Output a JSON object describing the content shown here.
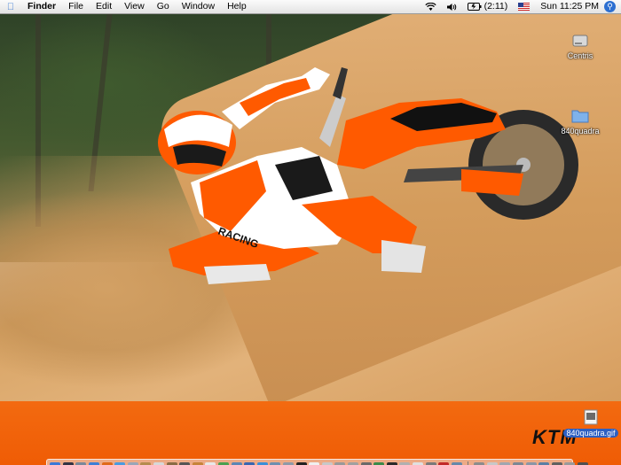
{
  "menubar": {
    "app_name": "Finder",
    "menus": [
      "File",
      "Edit",
      "View",
      "Go",
      "Window",
      "Help"
    ],
    "battery": "(2:11)",
    "clock": "Sun 11:25 PM"
  },
  "desktop": {
    "icons": [
      {
        "label": "Centris",
        "icon": "hard-drive-icon"
      },
      {
        "label": "840quadra",
        "icon": "folder-icon"
      },
      {
        "label": "840quadra.gif",
        "icon": "image-file-icon"
      }
    ],
    "wallpaper_logo": "KTM",
    "wallpaper_rider_text": "RACING"
  },
  "colors": {
    "brand_orange": "#ef5c05",
    "menubar": "#e8e8e8",
    "selection_blue": "#2d5fc2"
  },
  "dock": {
    "apps": [
      {
        "name": "finder-icon",
        "color": "#3b78d8"
      },
      {
        "name": "dashboard-icon",
        "color": "#333344"
      },
      {
        "name": "system-preferences-icon",
        "color": "#7a8899"
      },
      {
        "name": "safari-icon",
        "color": "#3d7fd6"
      },
      {
        "name": "firefox-icon",
        "color": "#e06a1a"
      },
      {
        "name": "ichat-icon",
        "color": "#4a9be0"
      },
      {
        "name": "mail-icon",
        "color": "#9aa6b8"
      },
      {
        "name": "address-book-icon",
        "color": "#b58c4e"
      },
      {
        "name": "textedit-icon",
        "color": "#d8d8d8"
      },
      {
        "name": "preview-icon",
        "color": "#8a6c44"
      },
      {
        "name": "imovie-icon",
        "color": "#555555"
      },
      {
        "name": "guitar-icon",
        "color": "#c7843a"
      },
      {
        "name": "ical-icon",
        "color": "#e8e8e8"
      },
      {
        "name": "itunes-icon",
        "color": "#4aa050"
      },
      {
        "name": "iphoto-icon",
        "color": "#5b86b5"
      },
      {
        "name": "quicktime-icon",
        "color": "#3a66b0"
      },
      {
        "name": "itunes-store-icon",
        "color": "#3a8fd8"
      },
      {
        "name": "network-icon",
        "color": "#6e8fb0"
      },
      {
        "name": "disk-utility-icon",
        "color": "#8f9aa8"
      },
      {
        "name": "terminal-icon",
        "color": "#222222"
      },
      {
        "name": "x11-icon",
        "color": "#f0f0f0"
      },
      {
        "name": "script-editor-icon",
        "color": "#c8c8c8"
      },
      {
        "name": "preview-photo-icon",
        "color": "#9a9a9a"
      },
      {
        "name": "printer-icon",
        "color": "#a0a0a0"
      },
      {
        "name": "utility-icon",
        "color": "#6a6a6a"
      },
      {
        "name": "globe-icon",
        "color": "#3b8a4a"
      },
      {
        "name": "activity-monitor-icon",
        "color": "#2a2a2a"
      },
      {
        "name": "photo-booth-icon",
        "color": "#b0b0b0"
      },
      {
        "name": "grapher-icon",
        "color": "#e0e0e0"
      },
      {
        "name": "automator-icon",
        "color": "#7a7a7a"
      },
      {
        "name": "acrobat-icon",
        "color": "#c22a2a"
      },
      {
        "name": "remote-desktop-icon",
        "color": "#6688aa"
      }
    ],
    "trailing": [
      {
        "name": "stacks-icon",
        "color": "#8c8c8c"
      },
      {
        "name": "home-folder-icon",
        "color": "#c8c8c8"
      },
      {
        "name": "documents-folder-icon",
        "color": "#9fa6b0"
      },
      {
        "name": "applications-folder-icon",
        "color": "#7d8794"
      },
      {
        "name": "downloads-folder-icon",
        "color": "#8a96a6"
      },
      {
        "name": "picture-icon",
        "color": "#5a7fa5"
      },
      {
        "name": "movie-icon",
        "color": "#606060"
      },
      {
        "name": "window-icon",
        "color": "#9a9a9a"
      },
      {
        "name": "trash-icon",
        "color": "#505050"
      }
    ]
  }
}
